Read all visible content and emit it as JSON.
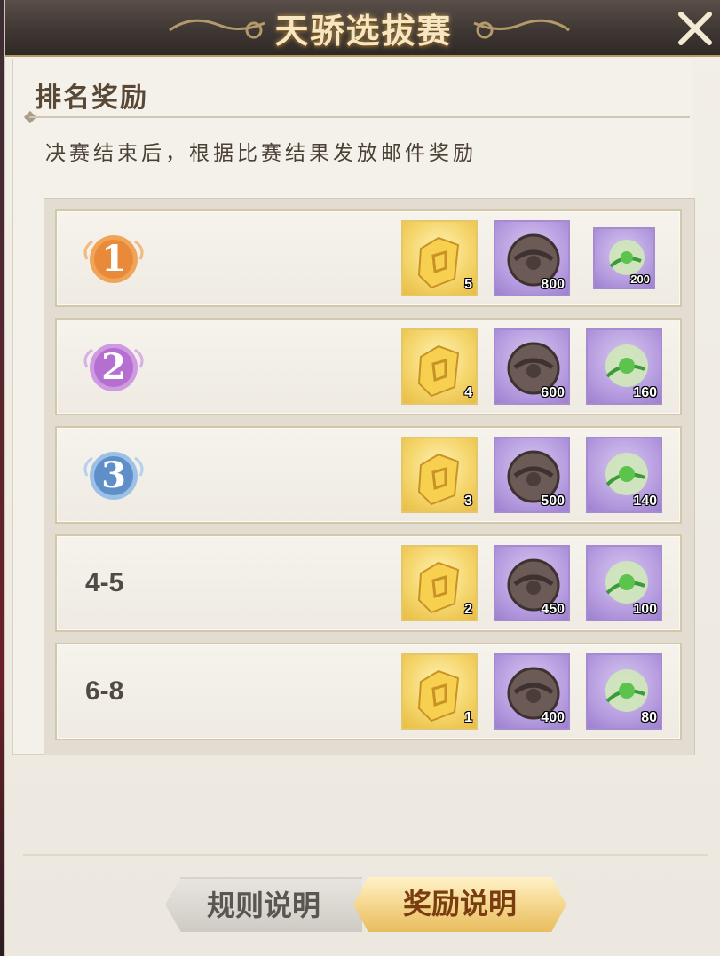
{
  "window": {
    "title": "天骄选拔赛"
  },
  "section": {
    "title": "排名奖励",
    "description": "决赛结束后，根据比赛结果发放邮件奖励"
  },
  "rows": [
    {
      "rank": "1",
      "rank_style": "badge",
      "badge_color": "#e98a3a",
      "rewards": [
        {
          "icon": "gold-token-icon",
          "count": "5"
        },
        {
          "icon": "bronze-coin-icon",
          "count": "800"
        },
        {
          "icon": "green-orb-icon",
          "count": "200"
        }
      ]
    },
    {
      "rank": "2",
      "rank_style": "badge",
      "badge_color": "#b56fd0",
      "rewards": [
        {
          "icon": "gold-token-icon",
          "count": "4"
        },
        {
          "icon": "bronze-coin-icon",
          "count": "600"
        },
        {
          "icon": "green-orb-icon",
          "count": "160"
        }
      ]
    },
    {
      "rank": "3",
      "rank_style": "badge",
      "badge_color": "#5f8fc8",
      "rewards": [
        {
          "icon": "gold-token-icon",
          "count": "3"
        },
        {
          "icon": "bronze-coin-icon",
          "count": "500"
        },
        {
          "icon": "green-orb-icon",
          "count": "140"
        }
      ]
    },
    {
      "rank": "4-5",
      "rank_style": "text",
      "rewards": [
        {
          "icon": "gold-token-icon",
          "count": "2"
        },
        {
          "icon": "bronze-coin-icon",
          "count": "450"
        },
        {
          "icon": "green-orb-icon",
          "count": "100"
        }
      ]
    },
    {
      "rank": "6-8",
      "rank_style": "text",
      "rewards": [
        {
          "icon": "gold-token-icon",
          "count": "1"
        },
        {
          "icon": "bronze-coin-icon",
          "count": "400"
        },
        {
          "icon": "green-orb-icon",
          "count": "80"
        }
      ]
    }
  ],
  "tabs": {
    "rules_label": "规则说明",
    "rewards_label": "奖励说明",
    "active": "rewards"
  },
  "colors": {
    "title_bar": "#3f3733",
    "title_text": "#f6e7c2",
    "active_tab": "#f4d489",
    "gold_tile": "#f5d66d",
    "purple_tile": "#b79ee0"
  }
}
